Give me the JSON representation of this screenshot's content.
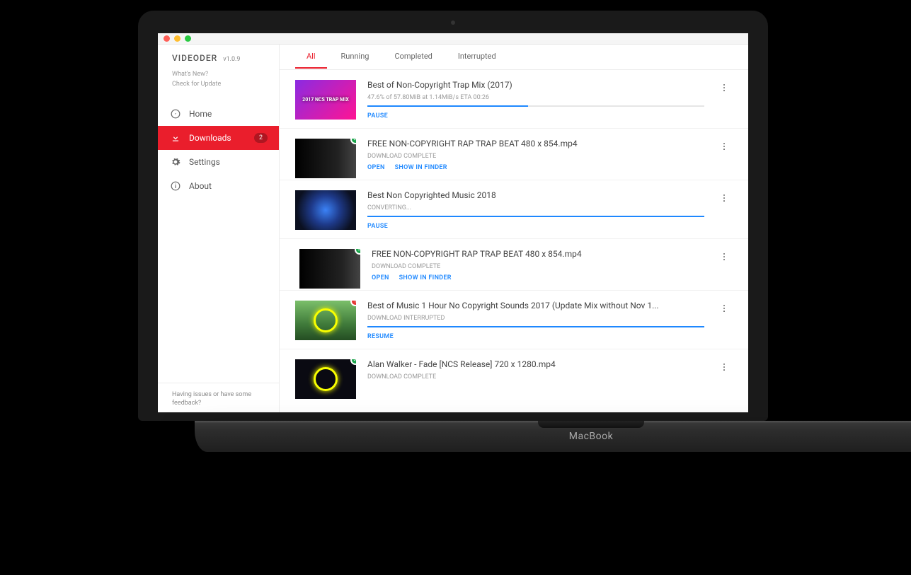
{
  "brand": {
    "name": "VIDEODER",
    "version": "v1.0.9"
  },
  "quickLinks": {
    "whatsNew": "What's New?",
    "checkUpdate": "Check for Update"
  },
  "nav": {
    "home": {
      "label": "Home"
    },
    "downloads": {
      "label": "Downloads",
      "badge": "2"
    },
    "settings": {
      "label": "Settings"
    },
    "about": {
      "label": "About"
    }
  },
  "footer": {
    "issues": "Having issues or have some feedback?"
  },
  "tabs": {
    "all": "All",
    "running": "Running",
    "completed": "Completed",
    "interrupted": "Interrupted"
  },
  "rows": [
    {
      "title": "Best of Non-Copyright Trap Mix (2017)",
      "sub": "47.6% of 57.80MiB at 1.14MiB/s ETA 00:26",
      "progress": 47.6,
      "actions": [
        "PAUSE"
      ],
      "thumbLabel": "2017 NCS TRAP MIX",
      "status": ""
    },
    {
      "title": "FREE NON-COPYRIGHT RAP TRAP BEAT 480 x 854.mp4",
      "sub": "DOWNLOAD COMPLETE",
      "progress": null,
      "actions": [
        "OPEN",
        "SHOW IN FINDER"
      ],
      "thumbLabel": "",
      "status": "ok"
    },
    {
      "title": "Best Non Copyrighted Music 2018",
      "sub": "CONVERTING...",
      "progress": 100,
      "actions": [
        "PAUSE"
      ],
      "thumbLabel": "",
      "status": ""
    },
    {
      "title": "FREE NON-COPYRIGHT RAP TRAP BEAT 480 x 854.mp4",
      "sub": "DOWNLOAD COMPLETE",
      "progress": null,
      "actions": [
        "OPEN",
        "SHOW IN FINDER"
      ],
      "thumbLabel": "",
      "status": "ok"
    },
    {
      "title": "Best of Music 1 Hour No Copyright Sounds 2017 (Update Mix without Nov 1...",
      "sub": "DOWNLOAD INTERRUPTED",
      "progress": 100,
      "actions": [
        "RESUME"
      ],
      "thumbLabel": "",
      "status": "err"
    },
    {
      "title": "Alan Walker - Fade [NCS Release] 720 x 1280.mp4",
      "sub": "DOWNLOAD COMPLETE",
      "progress": null,
      "actions": [],
      "thumbLabel": "",
      "status": "ok"
    }
  ],
  "device": {
    "label": "MacBook"
  }
}
